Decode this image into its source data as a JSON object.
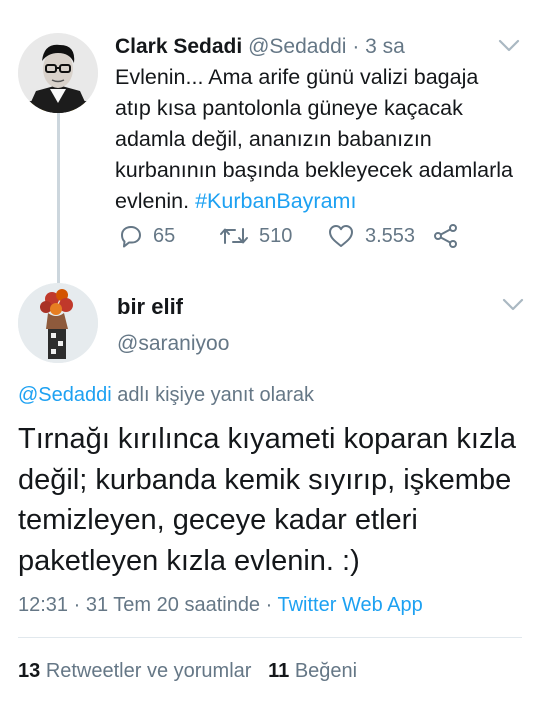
{
  "tweet": {
    "author_name": "Clark Sedadi",
    "author_handle": "@Sedaddi",
    "separator": "·",
    "time": "3 sa",
    "text_before_tag": "Evlenin... Ama arife günü valizi bagaja atıp kısa pantolonla güneye kaçacak adamla değil, ananızın babanızın kurbanının başında bekleyecek adamlarla evlenin. ",
    "hashtag": "#KurbanBayramı",
    "reply_count": "65",
    "retweet_count": "510",
    "like_count": "3.553"
  },
  "reply": {
    "author_name": "bir elif",
    "author_handle": "@saraniyoo",
    "reply_to_mention": "@Sedaddi",
    "reply_to_suffix": " adlı kişiye yanıt olarak",
    "text": "Tırnağı kırılınca kıyameti koparan kızla değil; kurbanda kemik sıyırıp, işkembe temizleyen, geceye kadar etleri paketleyen kızla evlenin. :)",
    "time": "12:31",
    "date": "31 Tem 20 saatinde",
    "separator": "·",
    "app": "Twitter Web App",
    "retweets_count": "13",
    "retweets_label": "Retweetler ve yorumlar",
    "likes_count": "11",
    "likes_label": "Beğeni"
  },
  "colors": {
    "accent": "#1da1f2",
    "secondary_text": "#657786",
    "primary_text": "#14171a",
    "divider": "#e1e8ed"
  },
  "icons": [
    "chevron-down-icon",
    "reply-icon",
    "retweet-icon",
    "like-icon",
    "share-icon"
  ]
}
